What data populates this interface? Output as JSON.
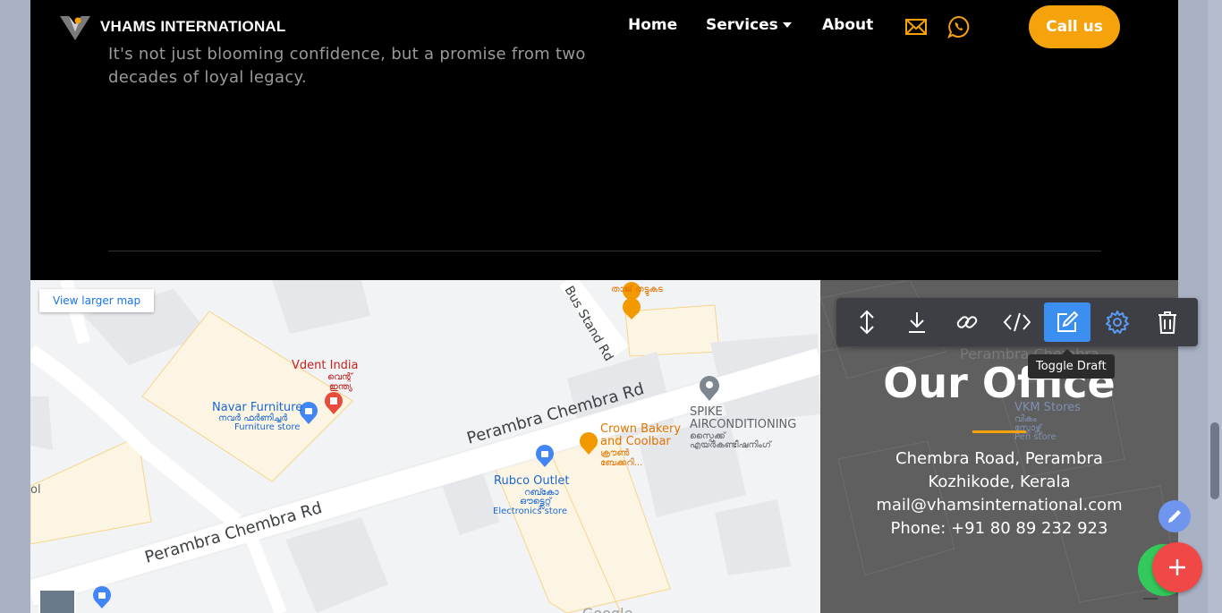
{
  "navbar": {
    "brand": "VHAMS INTERNATIONAL",
    "links": {
      "home": "Home",
      "services": "Services",
      "about": "About"
    },
    "icons": {
      "mail": "mail-icon",
      "whatsapp": "whatsapp-icon"
    },
    "call_label": "Call us"
  },
  "hero": {
    "text": "It's not just blooming confidence, but a promise from two decades of loyal legacy."
  },
  "map": {
    "view_larger": "View larger map",
    "roads": {
      "main_1": "Perambra Chembra Rd",
      "main_2": "Perambra Chembra Rd",
      "bus_stand": "Bus Stand Rd"
    },
    "places": {
      "vdent_en": "Vdent India",
      "vdent_ml_1": "വെന്റ്",
      "vdent_ml_2": "ഇന്ത്യ",
      "navar_en": "Navar Furniture",
      "navar_ml": "നവർ ഫർണിച്ചർ",
      "navar_type": "Furniture store",
      "crown_en_1": "Crown Bakery",
      "crown_en_2": "and Coolbar",
      "crown_ml_1": "ക്രൗൺ",
      "crown_ml_2": "ബേക്കറി...",
      "rubco_en": "Rubco Outlet",
      "rubco_ml_1": "റബ്കോ",
      "rubco_ml_2": "ഔട്ട്ലെറ്റ്",
      "rubco_type": "Electronics store",
      "spike_en_1": "SPIKE",
      "spike_en_2": "AIRCONDITIONING",
      "spike_ml_1": "സ്പൈക്ക്",
      "spike_ml_2": "എയർകണ്ടീഷനിംഗ്",
      "taj_ml": "താജ് തട്ടുകട",
      "left_cut": "ol",
      "google": "Google"
    }
  },
  "office": {
    "title": "Our Office",
    "address_1": "Chembra Road, Perambra",
    "address_2": "Kozhikode, Kerala",
    "email": "mail@vhamsinternational.com",
    "phone": "Phone: +91 80 89 232 923",
    "bg_map_labels": {
      "road": "Perambra Chembra",
      "vkm": "VKM Stores",
      "vkm_ml_1": "വികം",
      "vkm_ml_2": "സ്റ്റോഴ്സ്",
      "vkm_type": "Pen store"
    }
  },
  "toolbar": {
    "buttons": [
      "move-icon",
      "download-icon",
      "link-icon",
      "code-icon",
      "edit-draft-icon",
      "settings-icon",
      "trash-icon"
    ],
    "tooltip": "Toggle Draft"
  },
  "colors": {
    "accent": "#f5a20b",
    "toolbar_active": "#3b8ff0",
    "fab_red": "#f04747",
    "fab_green": "#33c95c"
  }
}
